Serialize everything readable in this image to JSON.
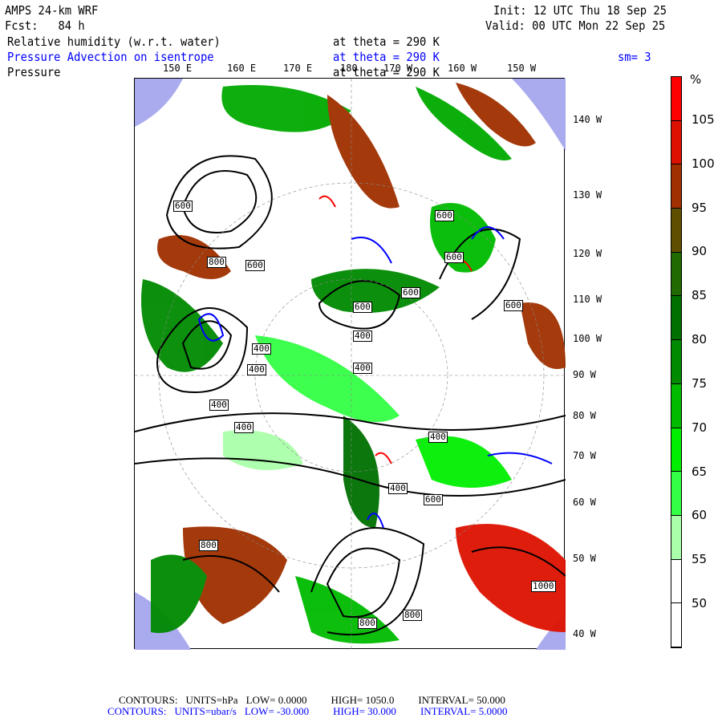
{
  "header": {
    "model": "AMPS 24-km WRF",
    "forecast": "Fcst:   84 h",
    "init": "Init: 12 UTC Thu 18 Sep 25",
    "valid": "Valid: 00 UTC Mon 22 Sep 25",
    "field1": "Relative humidity (w.r.t. water)",
    "field1_level": "at theta = 290 K",
    "field2": "Pressure Advection on isentrope",
    "field2_level": "at theta = 290 K",
    "smoothing": "sm= 3",
    "field3": "Pressure",
    "field3_level": "at theta = 290 K"
  },
  "map": {
    "top_lon_labels": [
      "150 E",
      "160 E",
      "170 E",
      "180",
      "170 W",
      "160 W",
      "150 W"
    ],
    "right_lon_labels": [
      "140 W",
      "130 W",
      "120 W",
      "110 W",
      "100 W",
      "90 W",
      "80 W",
      "70 W",
      "60 W",
      "50 W",
      "40 W"
    ],
    "contour_labels": [
      "600",
      "800",
      "600",
      "400",
      "400",
      "400",
      "400",
      "600",
      "400",
      "400",
      "600",
      "600",
      "600",
      "600",
      "400",
      "400",
      "800",
      "800",
      "800",
      "1000",
      "600"
    ]
  },
  "colorbar": {
    "unit": "%",
    "labels": [
      "105",
      "100",
      "95",
      "90",
      "85",
      "80",
      "75",
      "70",
      "65",
      "60",
      "55",
      "50"
    ],
    "colors": [
      "#ff0000",
      "#dd1100",
      "#a03000",
      "#604e00",
      "#206a00",
      "#007000",
      "#008a00",
      "#00bb00",
      "#00ee00",
      "#33ff44",
      "#aaffaa",
      "#ffffff",
      "#ffffff"
    ]
  },
  "footer": {
    "line1": {
      "label": "CONTOURS:",
      "units": "UNITS=hPa",
      "low": "LOW=   0.0000",
      "high": "HIGH=   1050.0",
      "interval": "INTERVAL=    50.000"
    },
    "line2": {
      "label": "CONTOURS:",
      "units": "UNITS=ubar/s",
      "low": "LOW= -30.000",
      "high": "HIGH=   30.000",
      "interval": "INTERVAL=    5.0000"
    }
  }
}
